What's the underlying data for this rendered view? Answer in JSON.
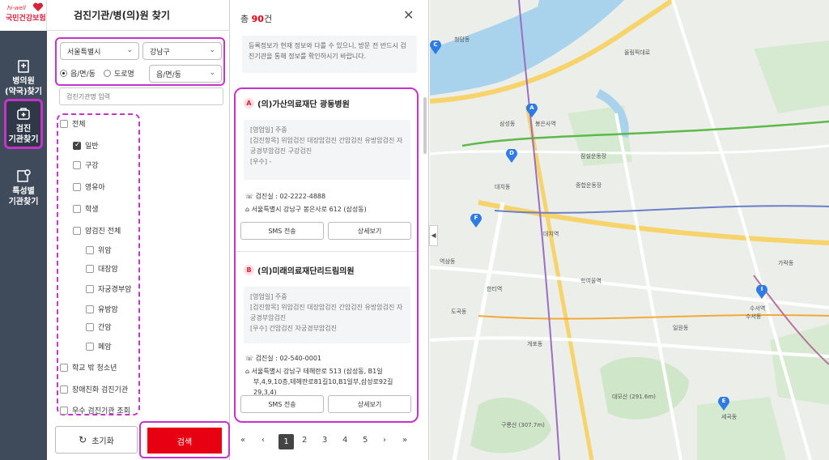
{
  "brand": {
    "hiwell": "hi-well",
    "name": "국민건강보험",
    "accent": "#d6223a"
  },
  "rail": [
    {
      "line1": "병의원",
      "line2": "(약국)찾기",
      "icon": "hospital-icon"
    },
    {
      "line1": "검진",
      "line2": "기관찾기",
      "icon": "checkup-icon"
    },
    {
      "line1": "특성별",
      "line2": "기관찾기",
      "icon": "feature-icon"
    }
  ],
  "panel": {
    "title": "검진기관/병(의)원 찾기",
    "city": "서울특별시",
    "district": "강남구",
    "radio_town": "읍/면/동",
    "radio_road": "도로명",
    "town_select": "읍/면/동",
    "name_placeholder": "검진기관명 입력",
    "checkboxes": [
      {
        "label": "전체",
        "checked": false
      },
      {
        "label": "일반",
        "checked": true
      },
      {
        "label": "구강",
        "checked": false
      },
      {
        "label": "영유아",
        "checked": false
      },
      {
        "label": "학생",
        "checked": false
      },
      {
        "label": "암검진 전체",
        "checked": false
      },
      {
        "label": "위암",
        "checked": false
      },
      {
        "label": "대장암",
        "checked": false
      },
      {
        "label": "자궁경부암",
        "checked": false
      },
      {
        "label": "유방암",
        "checked": false
      },
      {
        "label": "간암",
        "checked": false
      },
      {
        "label": "폐암",
        "checked": false
      },
      {
        "label": "학교 밖 청소년",
        "checked": false
      },
      {
        "label": "장애친화 검진기관",
        "checked": false
      },
      {
        "label": "우수 검진기관 조회",
        "checked": false
      }
    ],
    "reset_label": "초기화",
    "search_label": "검색"
  },
  "results": {
    "count_prefix": "총 ",
    "count": "90",
    "count_suffix": "건",
    "notice": "등록정보가 현재 정보와 다를 수 있으니, 방문 전 반드시 검진기관을 통해 정보를 확인하시기 바랍니다.",
    "items": [
      {
        "badge": "A",
        "name": "(의)가산의료재단 광동병원",
        "info1": "[영업일] 주중",
        "info2": "[검진항목] 위암검진 대장암검진 간암검진 유방암검진 자궁경부암검진 구강검진",
        "info3": "[우수] -",
        "phone_label": "검진실 :",
        "phone": "02-2222-4888",
        "address": "서울특별시 강남구 봉은사로 612 (삼성동)",
        "sms": "SMS 전송",
        "detail": "상세보기"
      },
      {
        "badge": "B",
        "name": "(의)미래의료재단리드림의원",
        "info1": "[영업일] 주중",
        "info2": "[검진항목] 위암검진 대장암검진 간암검진 유방암검진 자궁경부암검진",
        "info3": "[우수] 간암검진 자궁경부암검진",
        "phone_label": "검진실 :",
        "phone": "02-540-0001",
        "address": "서울특별시 강남구 테헤란로 513 (삼성동, B1일부,4,9,10층,테헤란로81길10,B1일부,삼성로92길29,3,4)",
        "sms": "SMS 전송",
        "detail": "상세보기"
      }
    ],
    "pages": [
      "1",
      "2",
      "3",
      "4",
      "5"
    ]
  },
  "map": {
    "labels": [
      {
        "t": "청담동"
      },
      {
        "t": "삼성동"
      },
      {
        "t": "대치동"
      },
      {
        "t": "역삼동"
      },
      {
        "t": "잠실운동장"
      },
      {
        "t": "종합운동장"
      },
      {
        "t": "도곡동"
      },
      {
        "t": "개포동"
      },
      {
        "t": "일원동"
      },
      {
        "t": "수서동"
      },
      {
        "t": "세곡동"
      },
      {
        "t": "대모산 (291.6m)"
      },
      {
        "t": "구룡산 (307.7m)"
      },
      {
        "t": "올림픽대로"
      },
      {
        "t": "봉은사역"
      },
      {
        "t": "대치역"
      },
      {
        "t": "학여울역"
      },
      {
        "t": "수서역"
      },
      {
        "t": "한티역"
      },
      {
        "t": "가락동"
      }
    ],
    "pins": [
      {
        "label": "A"
      },
      {
        "label": "C"
      },
      {
        "label": "D"
      },
      {
        "label": "E"
      },
      {
        "label": "F"
      },
      {
        "label": "I"
      }
    ]
  }
}
